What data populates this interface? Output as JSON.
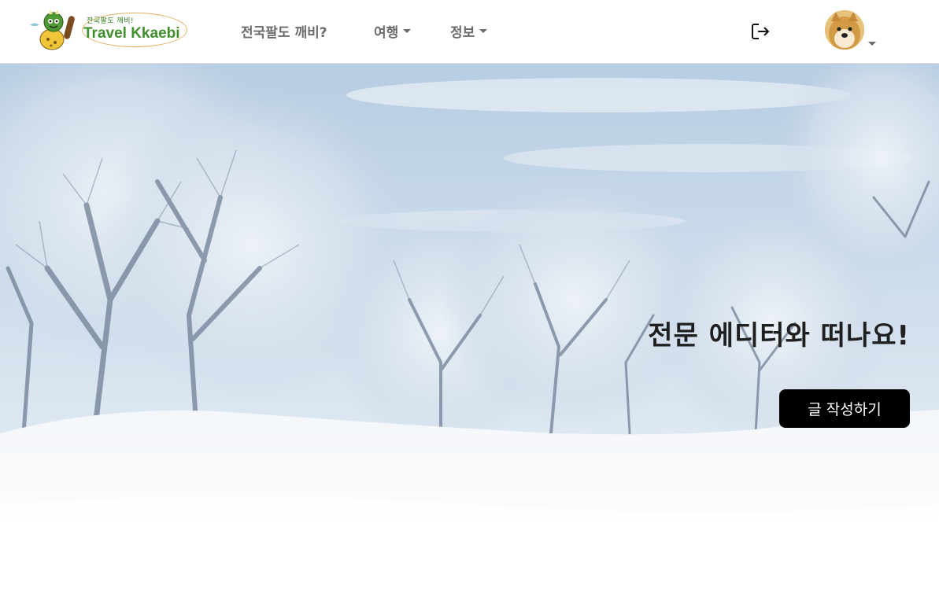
{
  "header": {
    "logo": {
      "small_text": "전국팔도 깨비!",
      "main_text": "Travel Kkaebi",
      "icon": "goblin-mascot-icon"
    },
    "nav": [
      {
        "label": "전국팔도 깨비?",
        "has_dropdown": false
      },
      {
        "label": "여행",
        "has_dropdown": true
      },
      {
        "label": "정보",
        "has_dropdown": true
      }
    ],
    "logout_icon": "logout-icon",
    "avatar_icon": "user-avatar-dog"
  },
  "hero": {
    "title": "전문 에디터와 떠나요!",
    "button_label": "글 작성하기",
    "background": "snowy-winter-forest"
  },
  "colors": {
    "nav_text": "#6b6b6b",
    "brand_green": "#3f8f2c",
    "button_bg": "#000000",
    "button_text": "#ffffff",
    "sky": "#c9daea"
  }
}
